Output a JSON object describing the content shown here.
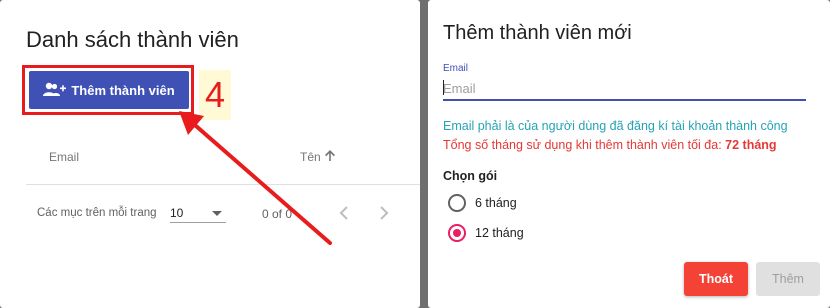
{
  "member_list": {
    "title": "Danh sách thành viên",
    "add_button_label": "Thêm thành viên",
    "step_number": "4",
    "columns": {
      "email": "Email",
      "name": "Tên"
    },
    "paginator": {
      "items_per_page_label": "Các mục trên mỗi trang",
      "page_size": "10",
      "range": "0 of 0"
    }
  },
  "add_member_form": {
    "title": "Thêm thành viên mới",
    "email_label": "Email",
    "email_placeholder": "Email",
    "email_hint": "Email phải là của người dùng đã đăng kí tài khoản thành công",
    "max_months_text": "Tổng số tháng sử dụng khi thêm thành viên tối đa:",
    "max_months_value": "72 tháng",
    "plan_label": "Chọn gói",
    "plans": [
      {
        "label": "6 tháng",
        "selected": false
      },
      {
        "label": "12 tháng",
        "selected": true
      }
    ],
    "exit_button": "Thoát",
    "add_button": "Thêm"
  },
  "colors": {
    "primary": "#3f51b5",
    "annotation_red": "#e81c1c",
    "hint_teal": "#26a2b5",
    "warning_red": "#e53935",
    "radio_pink": "#e91e63",
    "exit_red": "#f44336"
  },
  "icons": {
    "add_member": "person-add-icon",
    "sort": "arrow-up-icon",
    "prev": "chevron-left-icon",
    "next": "chevron-right-icon"
  }
}
